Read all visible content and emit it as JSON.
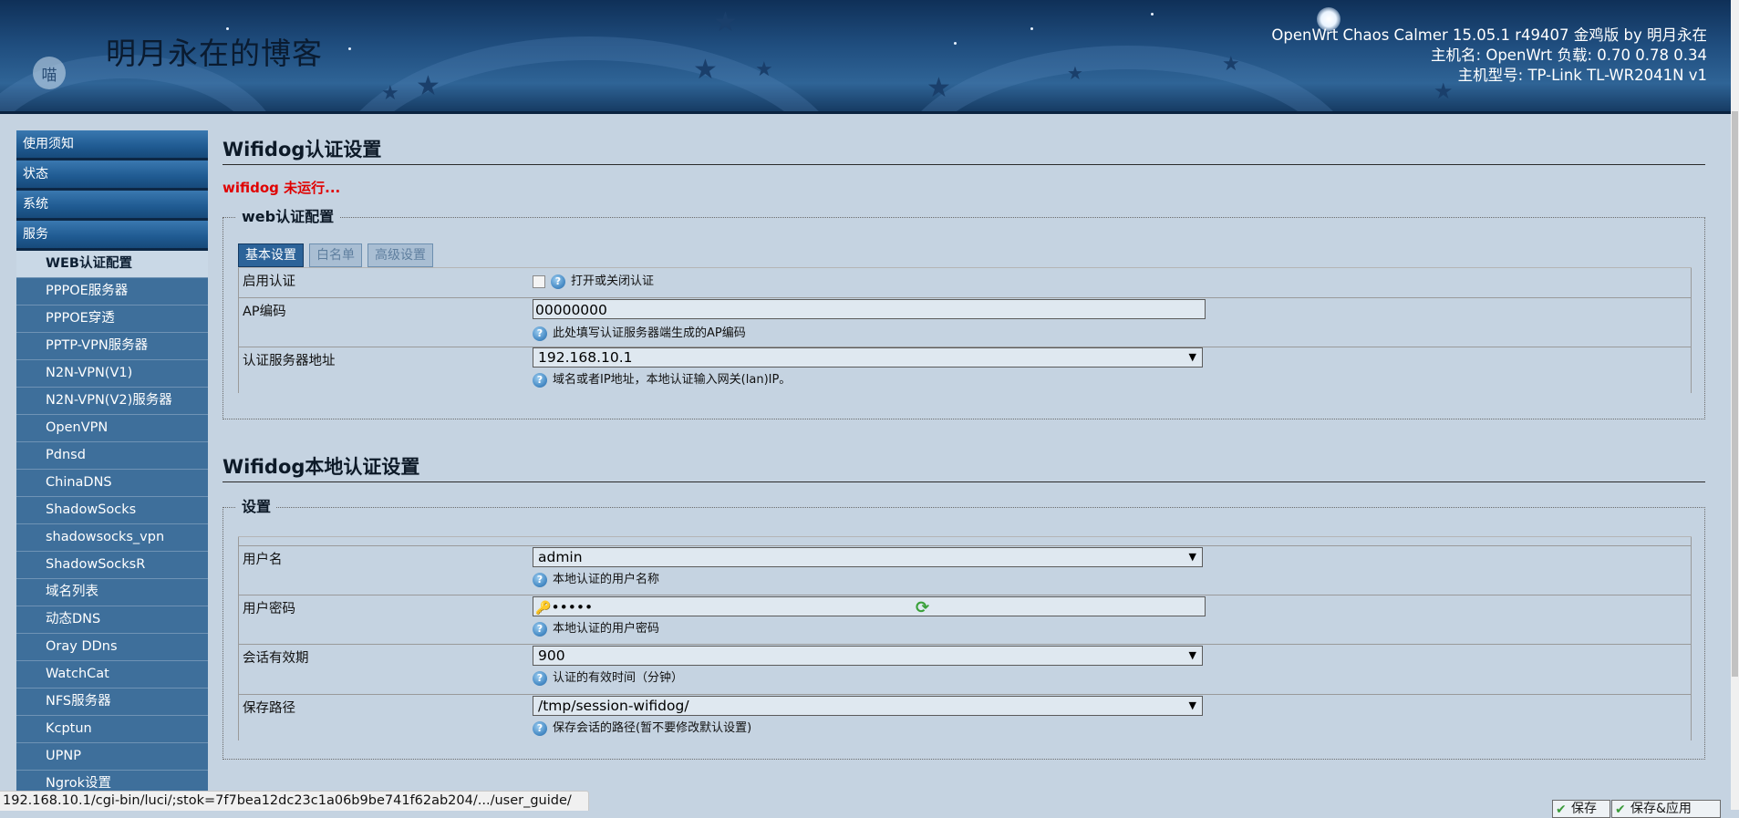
{
  "header": {
    "site_title": "明月永在的博客",
    "logo_char": "喵",
    "info_line1": "OpenWrt Chaos Calmer 15.05.1 r49407 金鸡版 by 明月永在",
    "info_line2": "主机名: OpenWrt 负载: 0.70 0.78 0.34",
    "info_line3": "主机型号: TP-Link TL-WR2041N v1"
  },
  "sidebar": {
    "top_items": [
      "使用须知",
      "状态",
      "系统",
      "服务"
    ],
    "sub_items": [
      "WEB认证配置",
      "PPPOE服务器",
      "PPPOE穿透",
      "PPTP-VPN服务器",
      "N2N-VPN(V1)",
      "N2N-VPN(V2)服务器",
      "OpenVPN",
      "Pdnsd",
      "ChinaDNS",
      "ShadowSocks",
      "shadowsocks_vpn",
      "ShadowSocksR",
      "域名列表",
      "动态DNS",
      "Oray DDns",
      "WatchCat",
      "NFS服务器",
      "Kcptun",
      "UPNP",
      "Ngrok设置"
    ],
    "active_sub": "WEB认证配置"
  },
  "section1": {
    "title": "Wifidog认证设置",
    "status": "wifidog 未运行...",
    "legend": "web认证配置",
    "tabs": [
      "基本设置",
      "白名单",
      "高级设置"
    ],
    "fields": {
      "enable": {
        "label": "启用认证",
        "hint": "打开或关闭认证",
        "checked": false
      },
      "ap_code": {
        "label": "AP编码",
        "value": "00000000",
        "hint": "此处填写认证服务器端生成的AP编码"
      },
      "server": {
        "label": "认证服务器地址",
        "value": "192.168.10.1",
        "hint": "域名或者IP地址，本地认证输入网关(lan)IP。"
      }
    }
  },
  "section2": {
    "title": "Wifidog本地认证设置",
    "legend": "设置",
    "fields": {
      "username": {
        "label": "用户名",
        "value": "admin",
        "hint": "本地认证的用户名称"
      },
      "password": {
        "label": "用户密码",
        "value": "•••••",
        "hint": "本地认证的用户密码"
      },
      "session": {
        "label": "会话有效期",
        "value": "900",
        "hint": "认证的有效时间（分钟）"
      },
      "path": {
        "label": "保存路径",
        "value": "/tmp/session-wifidog/",
        "hint": "保存会话的路径(暂不要修改默认设置)"
      }
    }
  },
  "icons": {
    "help": "?",
    "dropdown": "▼",
    "key": "🔑",
    "refresh": "⟳",
    "save_ok": "✔"
  },
  "buttons": {
    "save": "保存",
    "save_apply": "保存&应用"
  },
  "status_bar_url": "192.168.10.1/cgi-bin/luci/;stok=7f7bea12dc23c1a06b9be741f62ab204/.../user_guide/"
}
